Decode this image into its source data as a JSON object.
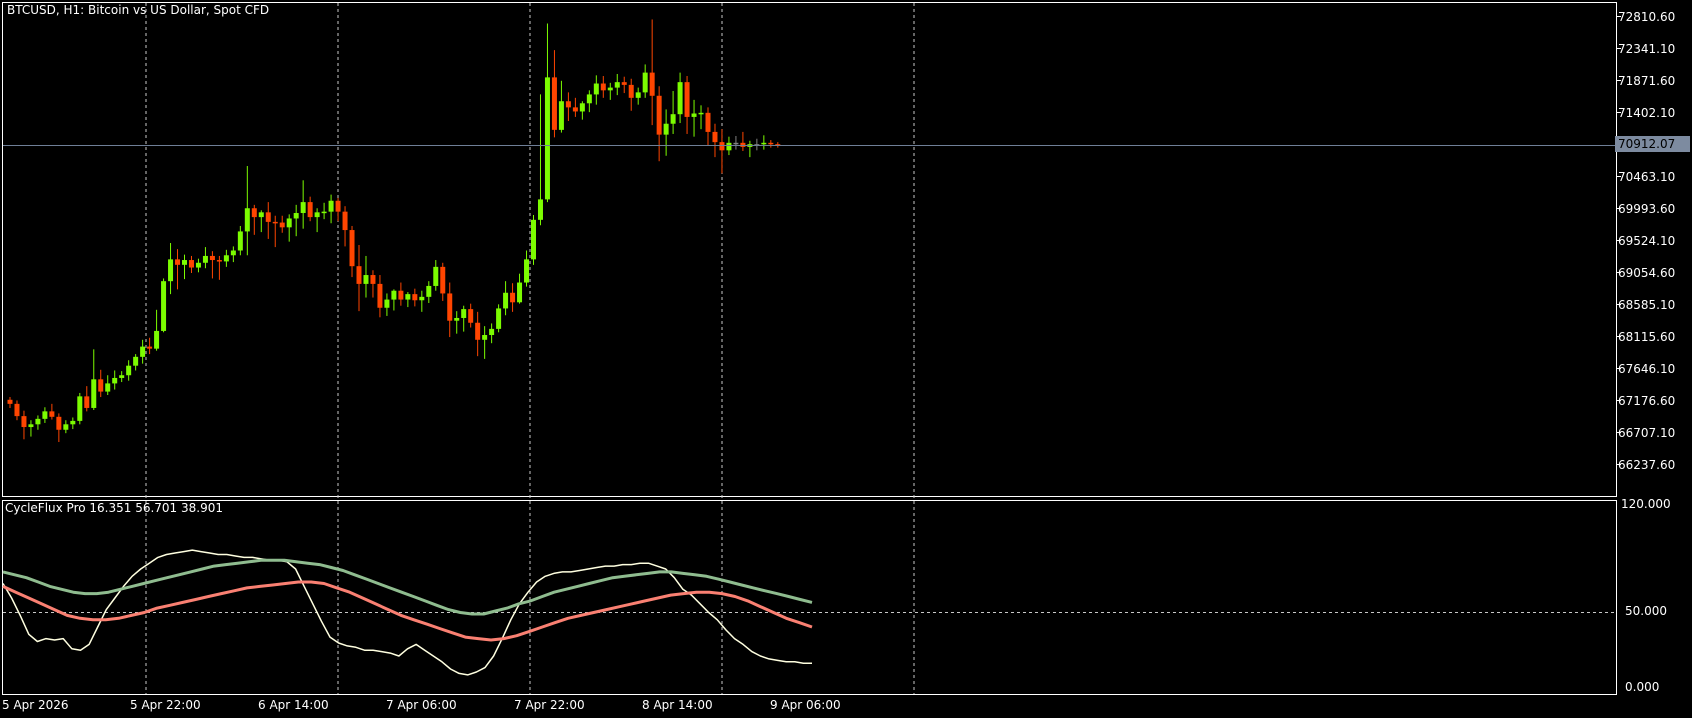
{
  "main_title": "BTCUSD, H1:  Bitcoin vs US Dollar, Spot CFD",
  "indicator_title": "CycleFlux Pro 16.351 56.701 38.901",
  "current_price": "70912.07",
  "price_labels": [
    "72810.60",
    "72341.10",
    "71871.60",
    "71402.10",
    "70463.10",
    "69993.60",
    "69524.10",
    "69054.60",
    "68585.10",
    "68115.60",
    "67646.10",
    "67176.60",
    "66707.10",
    "66237.60"
  ],
  "indicator_labels": [
    "120.000",
    "50.000",
    "0.000"
  ],
  "time_labels": [
    "5 Apr 2026",
    "5 Apr 22:00",
    "6 Apr 14:00",
    "7 Apr 06:00",
    "7 Apr 22:00",
    "8 Apr 14:00",
    "9 Apr 06:00"
  ],
  "colors": {
    "background": "#000000",
    "bull": "#7cfc00",
    "bear": "#ff4500",
    "doji": "#808080",
    "grid": "#c8c8c8",
    "price_line": "#6f7f97",
    "osc_fast": "#ffffe0",
    "osc_signal": "#fa8072",
    "osc_slow": "#8fbc8f"
  },
  "chart_data": [
    {
      "type": "candlestick",
      "symbol": "BTCUSD",
      "timeframe": "H1",
      "ylim": [
        65900,
        73000
      ],
      "current_price": 70912.07,
      "candles": [
        {
          "o": 67180,
          "h": 67220,
          "l": 67060,
          "c": 67120
        },
        {
          "o": 67120,
          "h": 67170,
          "l": 66880,
          "c": 66940
        },
        {
          "o": 66940,
          "h": 67020,
          "l": 66600,
          "c": 66780
        },
        {
          "o": 66780,
          "h": 66880,
          "l": 66640,
          "c": 66820
        },
        {
          "o": 66820,
          "h": 66950,
          "l": 66740,
          "c": 66900
        },
        {
          "o": 66900,
          "h": 67070,
          "l": 66840,
          "c": 67010
        },
        {
          "o": 67010,
          "h": 67120,
          "l": 66890,
          "c": 66930
        },
        {
          "o": 66930,
          "h": 66980,
          "l": 66560,
          "c": 66740
        },
        {
          "o": 66740,
          "h": 66880,
          "l": 66690,
          "c": 66820
        },
        {
          "o": 66820,
          "h": 66920,
          "l": 66750,
          "c": 66870
        },
        {
          "o": 66870,
          "h": 67280,
          "l": 66820,
          "c": 67230
        },
        {
          "o": 67230,
          "h": 67380,
          "l": 67010,
          "c": 67060
        },
        {
          "o": 67060,
          "h": 67920,
          "l": 67030,
          "c": 67480
        },
        {
          "o": 67480,
          "h": 67620,
          "l": 67220,
          "c": 67300
        },
        {
          "o": 67300,
          "h": 67540,
          "l": 67250,
          "c": 67420
        },
        {
          "o": 67420,
          "h": 67610,
          "l": 67330,
          "c": 67500
        },
        {
          "o": 67500,
          "h": 67600,
          "l": 67440,
          "c": 67540
        },
        {
          "o": 67540,
          "h": 67760,
          "l": 67460,
          "c": 67680
        },
        {
          "o": 67680,
          "h": 67850,
          "l": 67610,
          "c": 67810
        },
        {
          "o": 67810,
          "h": 68060,
          "l": 67710,
          "c": 67960
        },
        {
          "o": 67960,
          "h": 68090,
          "l": 67850,
          "c": 67930
        },
        {
          "o": 67930,
          "h": 68500,
          "l": 67900,
          "c": 68190
        },
        {
          "o": 68190,
          "h": 68960,
          "l": 68170,
          "c": 68920
        },
        {
          "o": 68920,
          "h": 69480,
          "l": 68730,
          "c": 69240
        },
        {
          "o": 69240,
          "h": 69390,
          "l": 68800,
          "c": 69160
        },
        {
          "o": 69160,
          "h": 69310,
          "l": 68950,
          "c": 69230
        },
        {
          "o": 69230,
          "h": 69290,
          "l": 69040,
          "c": 69120
        },
        {
          "o": 69120,
          "h": 69250,
          "l": 69050,
          "c": 69190
        },
        {
          "o": 69190,
          "h": 69420,
          "l": 69110,
          "c": 69290
        },
        {
          "o": 69290,
          "h": 69360,
          "l": 68960,
          "c": 69230
        },
        {
          "o": 69230,
          "h": 69290,
          "l": 68940,
          "c": 69210
        },
        {
          "o": 69210,
          "h": 69380,
          "l": 69130,
          "c": 69300
        },
        {
          "o": 69300,
          "h": 69430,
          "l": 69200,
          "c": 69370
        },
        {
          "o": 69370,
          "h": 69730,
          "l": 69300,
          "c": 69650
        },
        {
          "o": 69650,
          "h": 70610,
          "l": 69300,
          "c": 69990
        },
        {
          "o": 69990,
          "h": 70040,
          "l": 69600,
          "c": 69860
        },
        {
          "o": 69860,
          "h": 69960,
          "l": 69640,
          "c": 69930
        },
        {
          "o": 69930,
          "h": 70080,
          "l": 69540,
          "c": 69790
        },
        {
          "o": 69790,
          "h": 69880,
          "l": 69420,
          "c": 69780
        },
        {
          "o": 69780,
          "h": 69880,
          "l": 69630,
          "c": 69710
        },
        {
          "o": 69710,
          "h": 69900,
          "l": 69500,
          "c": 69840
        },
        {
          "o": 69840,
          "h": 70040,
          "l": 69580,
          "c": 69920
        },
        {
          "o": 69920,
          "h": 70400,
          "l": 69690,
          "c": 70080
        },
        {
          "o": 70080,
          "h": 70160,
          "l": 69800,
          "c": 69860
        },
        {
          "o": 69860,
          "h": 69990,
          "l": 69640,
          "c": 69930
        },
        {
          "o": 69930,
          "h": 70070,
          "l": 69830,
          "c": 69940
        },
        {
          "o": 69940,
          "h": 70190,
          "l": 69770,
          "c": 70100
        },
        {
          "o": 70100,
          "h": 70140,
          "l": 69800,
          "c": 69940
        },
        {
          "o": 69940,
          "h": 70020,
          "l": 69430,
          "c": 69670
        },
        {
          "o": 69670,
          "h": 69730,
          "l": 68980,
          "c": 69140
        },
        {
          "o": 69140,
          "h": 69450,
          "l": 68480,
          "c": 68880
        },
        {
          "o": 68880,
          "h": 69290,
          "l": 68680,
          "c": 69010
        },
        {
          "o": 69010,
          "h": 69080,
          "l": 68680,
          "c": 68880
        },
        {
          "o": 68880,
          "h": 69010,
          "l": 68390,
          "c": 68530
        },
        {
          "o": 68530,
          "h": 68740,
          "l": 68410,
          "c": 68650
        },
        {
          "o": 68650,
          "h": 68800,
          "l": 68490,
          "c": 68780
        },
        {
          "o": 68780,
          "h": 68900,
          "l": 68560,
          "c": 68650
        },
        {
          "o": 68650,
          "h": 68760,
          "l": 68540,
          "c": 68730
        },
        {
          "o": 68730,
          "h": 68810,
          "l": 68550,
          "c": 68640
        },
        {
          "o": 68640,
          "h": 68780,
          "l": 68470,
          "c": 68690
        },
        {
          "o": 68690,
          "h": 68920,
          "l": 68600,
          "c": 68850
        },
        {
          "o": 68850,
          "h": 69230,
          "l": 68780,
          "c": 69130
        },
        {
          "o": 69130,
          "h": 69190,
          "l": 68630,
          "c": 68740
        },
        {
          "o": 68740,
          "h": 68900,
          "l": 68100,
          "c": 68340
        },
        {
          "o": 68340,
          "h": 68480,
          "l": 68150,
          "c": 68380
        },
        {
          "o": 68380,
          "h": 68560,
          "l": 68180,
          "c": 68510
        },
        {
          "o": 68510,
          "h": 68590,
          "l": 68240,
          "c": 68310
        },
        {
          "o": 68310,
          "h": 68470,
          "l": 67820,
          "c": 68060
        },
        {
          "o": 68060,
          "h": 68260,
          "l": 67780,
          "c": 68130
        },
        {
          "o": 68130,
          "h": 68300,
          "l": 68010,
          "c": 68220
        },
        {
          "o": 68220,
          "h": 68580,
          "l": 68170,
          "c": 68520
        },
        {
          "o": 68520,
          "h": 68920,
          "l": 68420,
          "c": 68750
        },
        {
          "o": 68750,
          "h": 68890,
          "l": 68470,
          "c": 68610
        },
        {
          "o": 68610,
          "h": 69030,
          "l": 68590,
          "c": 68900
        },
        {
          "o": 68900,
          "h": 69370,
          "l": 68840,
          "c": 69240
        },
        {
          "o": 69240,
          "h": 69890,
          "l": 69160,
          "c": 69820
        },
        {
          "o": 69820,
          "h": 71660,
          "l": 69740,
          "c": 70120
        },
        {
          "o": 70120,
          "h": 72700,
          "l": 70080,
          "c": 71910
        },
        {
          "o": 71910,
          "h": 72310,
          "l": 71030,
          "c": 71140
        },
        {
          "o": 71140,
          "h": 71860,
          "l": 71100,
          "c": 71560
        },
        {
          "o": 71560,
          "h": 71690,
          "l": 71270,
          "c": 71470
        },
        {
          "o": 71470,
          "h": 71610,
          "l": 71330,
          "c": 71410
        },
        {
          "o": 71410,
          "h": 71560,
          "l": 71290,
          "c": 71530
        },
        {
          "o": 71530,
          "h": 71720,
          "l": 71400,
          "c": 71660
        },
        {
          "o": 71660,
          "h": 71940,
          "l": 71510,
          "c": 71820
        },
        {
          "o": 71820,
          "h": 71930,
          "l": 71610,
          "c": 71720
        },
        {
          "o": 71720,
          "h": 71830,
          "l": 71580,
          "c": 71760
        },
        {
          "o": 71760,
          "h": 71960,
          "l": 71650,
          "c": 71840
        },
        {
          "o": 71840,
          "h": 71920,
          "l": 71680,
          "c": 71800
        },
        {
          "o": 71800,
          "h": 71890,
          "l": 71420,
          "c": 71610
        },
        {
          "o": 71610,
          "h": 71760,
          "l": 71510,
          "c": 71690
        },
        {
          "o": 71690,
          "h": 72100,
          "l": 71610,
          "c": 71980
        },
        {
          "o": 71980,
          "h": 72760,
          "l": 71210,
          "c": 71640
        },
        {
          "o": 71640,
          "h": 71780,
          "l": 70680,
          "c": 71070
        },
        {
          "o": 71070,
          "h": 71440,
          "l": 70760,
          "c": 71230
        },
        {
          "o": 71230,
          "h": 71710,
          "l": 71080,
          "c": 71370
        },
        {
          "o": 71370,
          "h": 71980,
          "l": 71240,
          "c": 71840
        },
        {
          "o": 71840,
          "h": 71930,
          "l": 71080,
          "c": 71330
        },
        {
          "o": 71330,
          "h": 71580,
          "l": 71040,
          "c": 71380
        },
        {
          "o": 71380,
          "h": 71500,
          "l": 71150,
          "c": 71390
        },
        {
          "o": 71390,
          "h": 71470,
          "l": 70910,
          "c": 71110
        },
        {
          "o": 71110,
          "h": 71230,
          "l": 70740,
          "c": 70960
        },
        {
          "o": 70960,
          "h": 71150,
          "l": 70500,
          "c": 70840
        },
        {
          "o": 70840,
          "h": 71040,
          "l": 70770,
          "c": 70950
        },
        {
          "o": 70950,
          "h": 71050,
          "l": 70850,
          "c": 70950
        },
        {
          "o": 70950,
          "h": 71110,
          "l": 70830,
          "c": 70890
        },
        {
          "o": 70890,
          "h": 70980,
          "l": 70740,
          "c": 70930
        },
        {
          "o": 70930,
          "h": 71010,
          "l": 70840,
          "c": 70930
        },
        {
          "o": 70930,
          "h": 71060,
          "l": 70850,
          "c": 70950
        },
        {
          "o": 70950,
          "h": 70990,
          "l": 70880,
          "c": 70930
        },
        {
          "o": 70930,
          "h": 70960,
          "l": 70880,
          "c": 70912
        }
      ]
    },
    {
      "type": "line",
      "title": "CycleFlux Pro 16.351 56.701 38.901",
      "ylim": [
        0,
        120
      ],
      "levels": [
        50
      ],
      "series": [
        {
          "color": "#ffffe0",
          "values": [
            70,
            60,
            48,
            35,
            30,
            32,
            31,
            32,
            25,
            24,
            28,
            40,
            52,
            60,
            68,
            75,
            80,
            84,
            88,
            90,
            91,
            92,
            93,
            92,
            91,
            90,
            90,
            89,
            88,
            88,
            87,
            86,
            86,
            85,
            80,
            68,
            56,
            44,
            33,
            29,
            27,
            26,
            24,
            24,
            23,
            22,
            20,
            25,
            28,
            24,
            20,
            16,
            11,
            8,
            7,
            9,
            12,
            20,
            32,
            45,
            56,
            64,
            71,
            75,
            77,
            78,
            78,
            79,
            80,
            81,
            82,
            82,
            83,
            83,
            84,
            84,
            82,
            80,
            74,
            66,
            62,
            56,
            50,
            45,
            38,
            32,
            28,
            23,
            20,
            18,
            17,
            16,
            16,
            15,
            15
          ]
        },
        {
          "color": "#8fbc8f",
          "values": [
            78,
            76,
            74,
            71,
            68,
            66,
            64,
            63,
            63,
            64,
            66,
            68,
            70,
            72,
            74,
            76,
            78,
            80,
            82,
            83,
            84,
            85,
            86,
            86,
            86,
            85,
            84,
            83,
            81,
            79,
            76,
            73,
            70,
            67,
            64,
            61,
            58,
            55,
            52,
            50,
            49,
            49,
            51,
            53,
            56,
            58,
            61,
            64,
            66,
            68,
            70,
            72,
            74,
            75,
            76,
            77,
            78,
            78,
            77,
            76,
            75,
            73,
            71,
            69,
            67,
            65,
            63,
            61,
            59,
            57
          ]
        },
        {
          "color": "#fa8072",
          "values": [
            68,
            64,
            60,
            56,
            52,
            48,
            46,
            45,
            45,
            46,
            48,
            50,
            53,
            55,
            57,
            59,
            61,
            63,
            65,
            67,
            68,
            69,
            70,
            71,
            71,
            70,
            67,
            64,
            60,
            56,
            52,
            48,
            45,
            42,
            39,
            36,
            33,
            32,
            31,
            32,
            34,
            37,
            40,
            43,
            46,
            48,
            50,
            52,
            54,
            56,
            58,
            60,
            62,
            63,
            64,
            64,
            63,
            61,
            58,
            54,
            50,
            46,
            43,
            40
          ]
        }
      ]
    }
  ]
}
